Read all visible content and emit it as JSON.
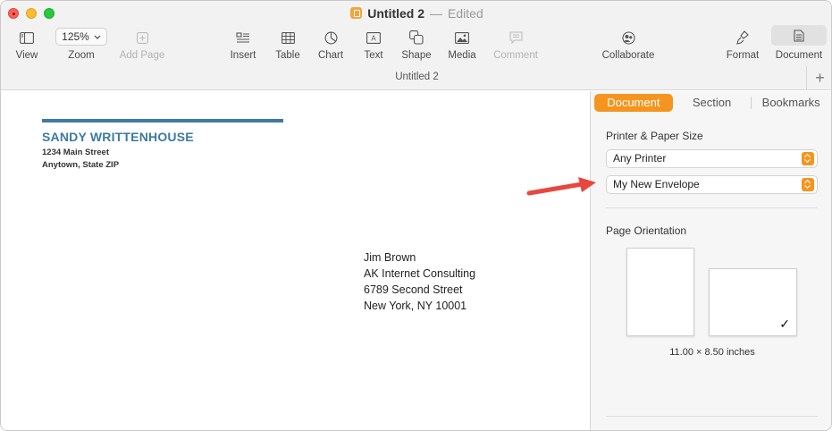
{
  "window": {
    "title": "Untitled 2",
    "separator": "—",
    "status": "Edited",
    "doc_subtitle": "Untitled 2"
  },
  "toolbar": {
    "view": "View",
    "zoom_value": "125%",
    "zoom": "Zoom",
    "add_page": "Add Page",
    "insert": "Insert",
    "table": "Table",
    "chart": "Chart",
    "text": "Text",
    "shape": "Shape",
    "media": "Media",
    "comment": "Comment",
    "collaborate": "Collaborate",
    "format": "Format",
    "document": "Document"
  },
  "document": {
    "sender": {
      "name": "SANDY WRITTENHOUSE",
      "street": "1234 Main Street",
      "city": "Anytown, State ZIP"
    },
    "recipient": {
      "name": "Jim Brown",
      "company": "AK Internet Consulting",
      "street": "6789 Second Street",
      "city": "New York, NY 10001"
    }
  },
  "inspector": {
    "tabs": [
      "Document",
      "Section",
      "Bookmarks"
    ],
    "active_tab": "Document",
    "printer_heading": "Printer & Paper Size",
    "printer_value": "Any Printer",
    "paper_value": "My New Envelope",
    "orientation_heading": "Page Orientation",
    "selected_orientation": "landscape",
    "dimensions": "11.00 × 8.50 inches",
    "add_label": "+"
  },
  "colors": {
    "accent": "#f5951f",
    "sender_blue": "#3d7aa3",
    "arrow": "#e8473d"
  }
}
